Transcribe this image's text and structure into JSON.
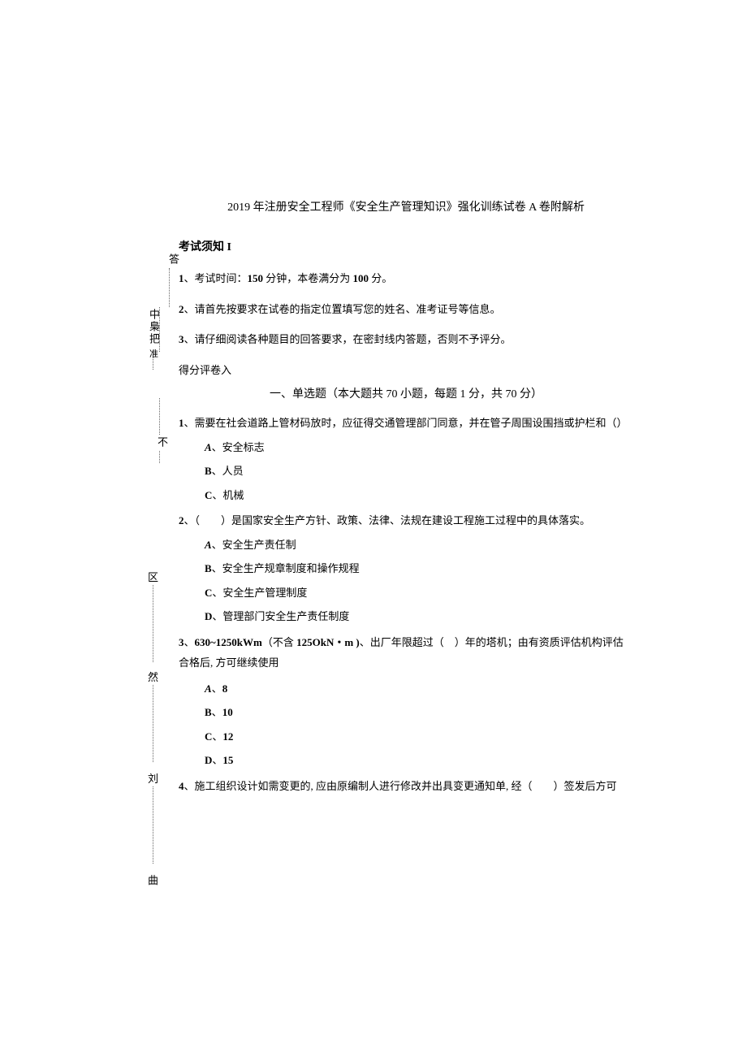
{
  "title": "2019 年注册安全工程师《安全生产管理知识》强化训练试卷 A 卷附解析",
  "notice": {
    "heading": "考试须知 I",
    "items": [
      {
        "num": "1",
        "strong1": "150",
        "text": "、考试时间：",
        "mid": " 分钟，本卷满分为 ",
        "strong2": "100",
        "tail": " 分。"
      },
      {
        "num": "2",
        "text": "、请首先按要求在试卷的指定位置填写您的姓名、准考证号等信息。"
      },
      {
        "num": "3",
        "text": "、请仔细阅读各种题目的回答要求，在密封线内答题，否则不予评分。"
      }
    ]
  },
  "score_row": "得分评卷入",
  "section": "一、单选题（本大题共 70 小题，每题 1 分，共 70 分）",
  "q1": {
    "num": "1",
    "text": "、需要在社会道路上管材码放时，应征得交通管理部门同意，并在管子周围设围挡或护栏和（）",
    "options": [
      {
        "label": "A",
        "text": "、安全标志"
      },
      {
        "label": "B",
        "text": "、人员"
      },
      {
        "label": "C",
        "text": "、机械"
      }
    ]
  },
  "q2": {
    "num": "2",
    "text": "、（　　）是国家安全生产方针、政策、法律、法规在建设工程施工过程中的具体落实。",
    "options": [
      {
        "label": "A",
        "text": "、安全生产责任制"
      },
      {
        "label": "B",
        "text": "、安全生产规章制度和操作规程"
      },
      {
        "label": "C",
        "text": "、安全生产管理制度"
      },
      {
        "label": "D",
        "text": "、管理部门安全生产责任制度"
      }
    ]
  },
  "q3": {
    "num": "3",
    "pre": "、",
    "strong1": "630~1250kWm",
    "mid1": "（不含 ",
    "strong2": "125OkN・m )",
    "mid2": "、出厂年限超过（　）年的塔机；由有资质评估机构评估",
    "line2": "合格后, 方可继续使用",
    "options": [
      {
        "label": "A",
        "text": "、",
        "val": "8"
      },
      {
        "label": "B",
        "text": "、",
        "val": "10"
      },
      {
        "label": "C",
        "text": "、",
        "val": "12"
      },
      {
        "label": "D",
        "text": "、",
        "val": "15"
      }
    ]
  },
  "q4": {
    "num": "4",
    "text": "、施工组织设计如需变更的, 应由原编制人进行修改并出具变更通知单, 经（　　）签发后方可"
  },
  "margin": {
    "g1": "答",
    "g2a": "中",
    "g2b": "梟",
    "g2c": "把",
    "g2d": "准",
    "g3": "不",
    "g4": "区",
    "g5": "然",
    "g6": "刘",
    "g7": "曲"
  }
}
